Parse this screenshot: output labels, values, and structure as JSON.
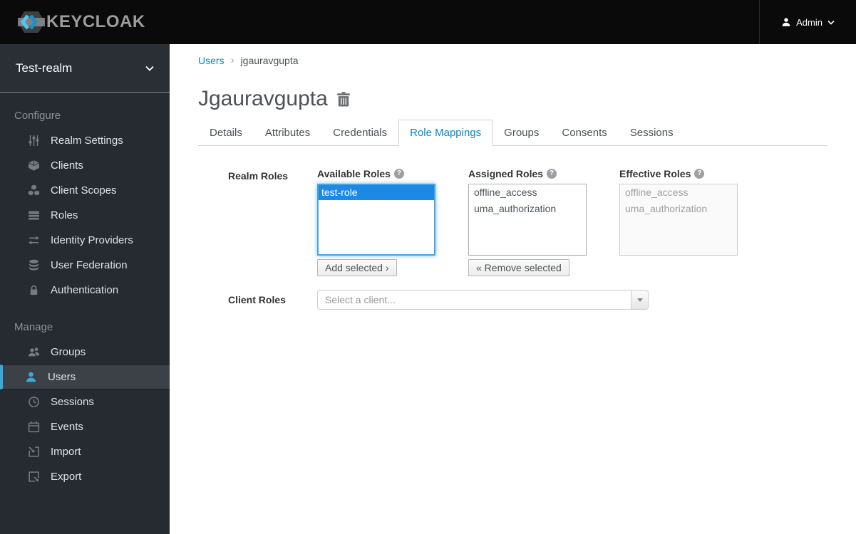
{
  "header": {
    "logo_text": "KEYCLOAK",
    "user_menu": {
      "label": "Admin"
    }
  },
  "sidebar": {
    "realm_selector": {
      "label": "Test-realm"
    },
    "sections": [
      {
        "label": "Configure",
        "items": [
          {
            "label": "Realm Settings",
            "icon": "sliders-icon"
          },
          {
            "label": "Clients",
            "icon": "cube-icon"
          },
          {
            "label": "Client Scopes",
            "icon": "cubes-icon"
          },
          {
            "label": "Roles",
            "icon": "list-icon"
          },
          {
            "label": "Identity Providers",
            "icon": "exchange-icon"
          },
          {
            "label": "User Federation",
            "icon": "database-icon"
          },
          {
            "label": "Authentication",
            "icon": "lock-icon"
          }
        ]
      },
      {
        "label": "Manage",
        "items": [
          {
            "label": "Groups",
            "icon": "group-icon"
          },
          {
            "label": "Users",
            "icon": "user-icon",
            "active": true
          },
          {
            "label": "Sessions",
            "icon": "clock-icon"
          },
          {
            "label": "Events",
            "icon": "calendar-icon"
          },
          {
            "label": "Import",
            "icon": "import-icon"
          },
          {
            "label": "Export",
            "icon": "export-icon"
          }
        ]
      }
    ]
  },
  "breadcrumb": {
    "link": "Users",
    "separator": "›",
    "current": "jgauravgupta"
  },
  "page": {
    "title": "Jgauravgupta"
  },
  "tabs": {
    "items": [
      "Details",
      "Attributes",
      "Credentials",
      "Role Mappings",
      "Groups",
      "Consents",
      "Sessions"
    ],
    "active": "Role Mappings"
  },
  "form": {
    "realm_roles_label": "Realm Roles",
    "client_roles_label": "Client Roles",
    "available": {
      "label": "Available Roles",
      "items": [
        "test-role"
      ],
      "selected_item": "test-role",
      "button_label": "Add selected ›"
    },
    "assigned": {
      "label": "Assigned Roles",
      "items": [
        "offline_access",
        "uma_authorization"
      ],
      "button_label": "« Remove selected"
    },
    "effective": {
      "label": "Effective Roles",
      "items": [
        "offline_access",
        "uma_authorization"
      ]
    },
    "client_select": {
      "placeholder": "Select a client..."
    }
  },
  "icons": {
    "help": "?"
  },
  "colors": {
    "accent_blue": "#0088ce",
    "selection_blue": "#1e88e5",
    "sidebar_active_blue": "#39a9dc",
    "header_bg": "#0a0a0a",
    "sidebar_bg": "#262b31"
  }
}
